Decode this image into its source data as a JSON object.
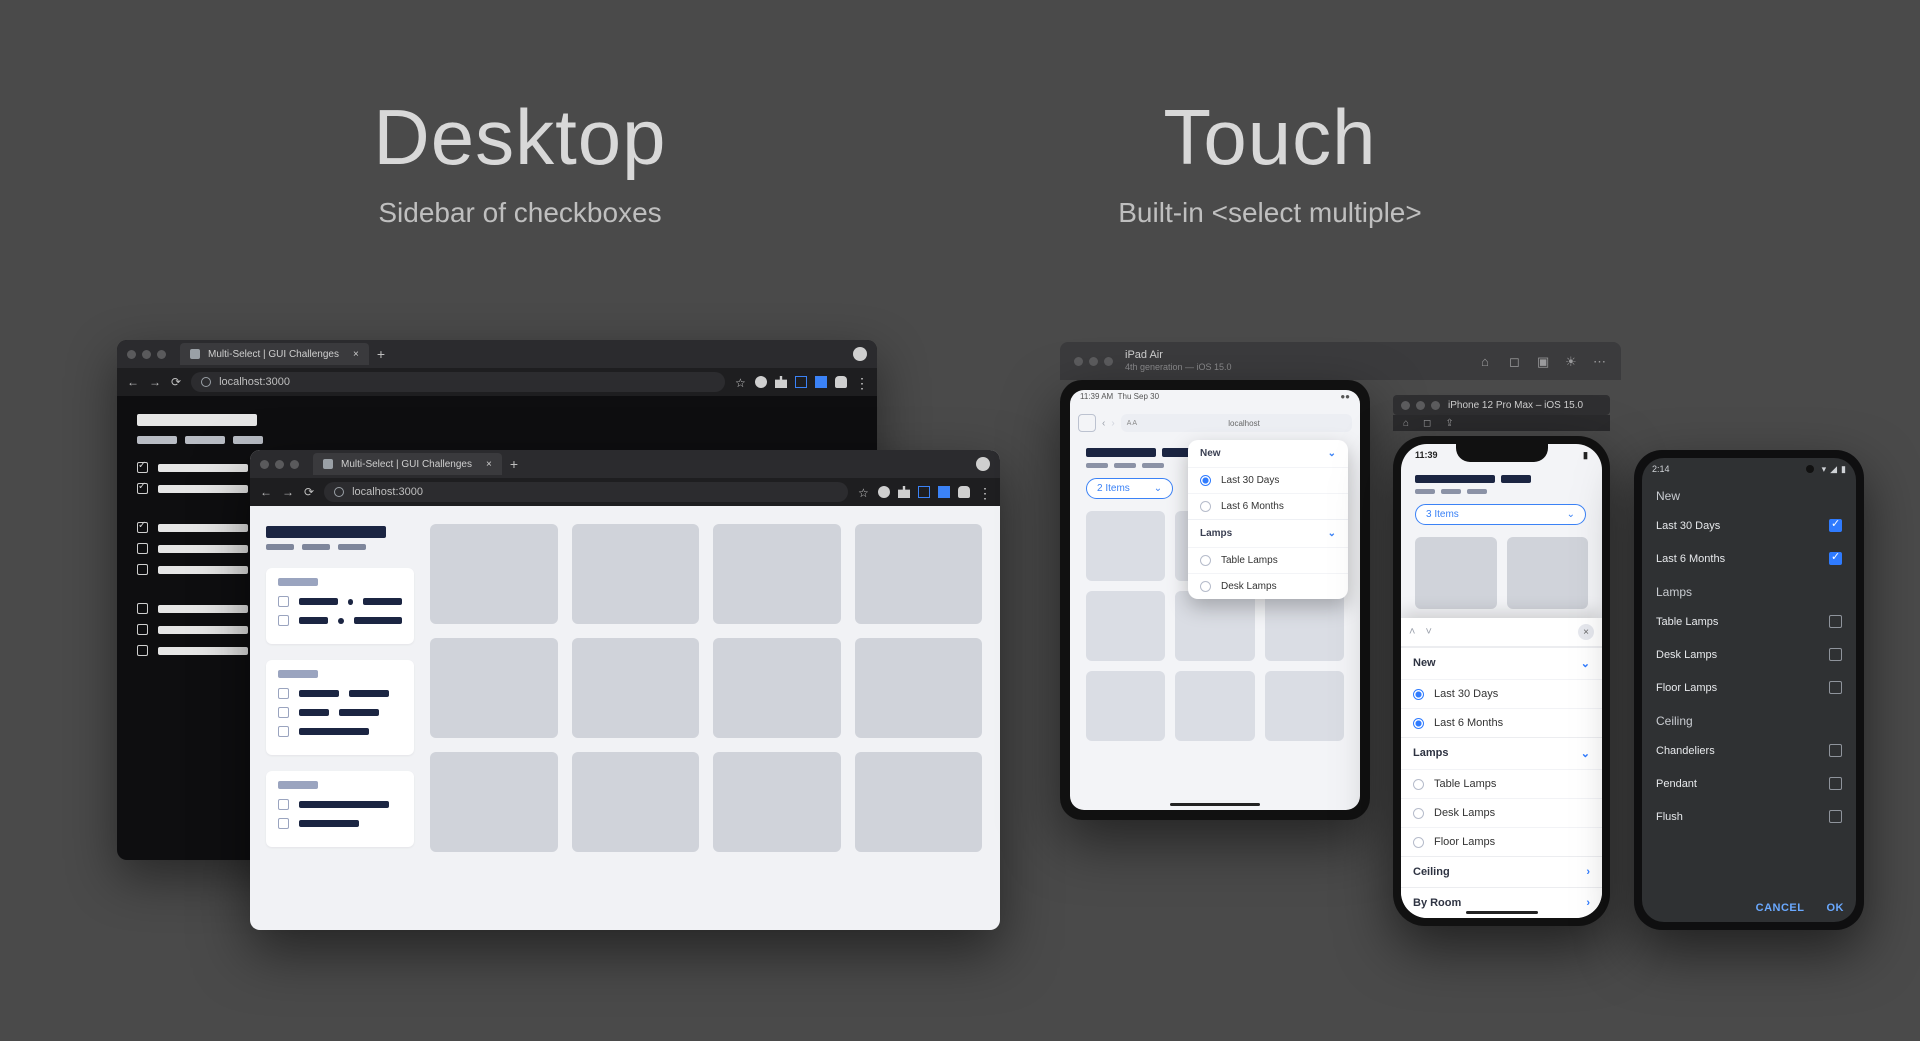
{
  "headings": {
    "desktop": {
      "title": "Desktop",
      "subtitle": "Sidebar of checkboxes"
    },
    "touch": {
      "title": "Touch",
      "subtitle": "Built-in <select multiple>"
    }
  },
  "browser": {
    "tab_title": "Multi-Select | GUI Challenges",
    "url": "localhost:3000"
  },
  "simulator": {
    "device": "iPad Air",
    "subtitle": "4th generation — iOS 15.0",
    "iphone_title": "iPhone 12 Pro Max – iOS 15.0"
  },
  "ipad": {
    "status_left": "11:39 AM",
    "status_right": "Thu Sep 30",
    "url_host": "localhost",
    "pill_label": "2 Items",
    "popover": {
      "sections": [
        {
          "title": "New",
          "items": [
            {
              "label": "Last 30 Days",
              "selected": true
            },
            {
              "label": "Last 6 Months",
              "selected": false
            }
          ]
        },
        {
          "title": "Lamps",
          "items": [
            {
              "label": "Table Lamps",
              "selected": false
            },
            {
              "label": "Desk Lamps",
              "selected": false
            }
          ]
        }
      ]
    }
  },
  "iphone": {
    "time": "11:39",
    "pill_label": "3 Items",
    "sheet": {
      "sections": [
        {
          "title": "New",
          "chev": "⌄",
          "items": [
            {
              "label": "Last 30 Days",
              "selected": true
            },
            {
              "label": "Last 6 Months",
              "selected": true
            }
          ]
        },
        {
          "title": "Lamps",
          "chev": "⌄",
          "items": [
            {
              "label": "Table Lamps",
              "selected": false
            },
            {
              "label": "Desk Lamps",
              "selected": false
            },
            {
              "label": "Floor Lamps",
              "selected": false
            }
          ]
        },
        {
          "title": "Ceiling",
          "chev": "›",
          "items": []
        },
        {
          "title": "By Room",
          "chev": "›",
          "items": []
        }
      ]
    }
  },
  "android": {
    "time": "2:14",
    "sections": [
      {
        "title": "New",
        "items": [
          {
            "label": "Last 30 Days",
            "checked": true
          },
          {
            "label": "Last 6 Months",
            "checked": true
          }
        ]
      },
      {
        "title": "Lamps",
        "items": [
          {
            "label": "Table Lamps",
            "checked": false
          },
          {
            "label": "Desk Lamps",
            "checked": false
          },
          {
            "label": "Floor Lamps",
            "checked": false
          }
        ]
      },
      {
        "title": "Ceiling",
        "items": [
          {
            "label": "Chandeliers",
            "checked": false
          },
          {
            "label": "Pendant",
            "checked": false
          },
          {
            "label": "Flush",
            "checked": false
          }
        ]
      }
    ],
    "actions": {
      "cancel": "CANCEL",
      "ok": "OK"
    }
  }
}
